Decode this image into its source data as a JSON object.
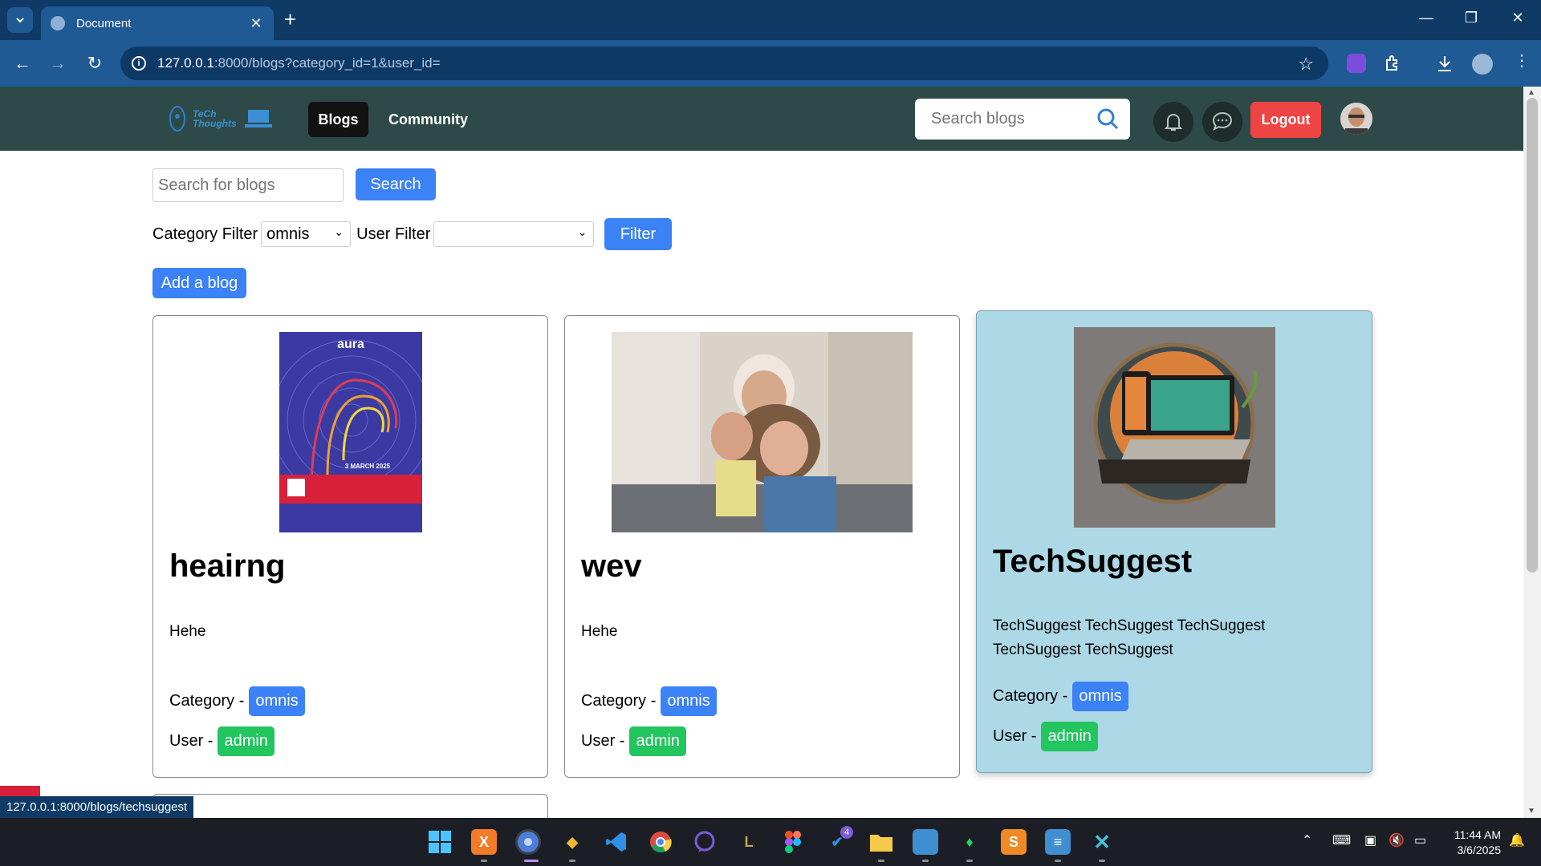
{
  "browser": {
    "tab_title": "Document",
    "url_host": "127.0.0.1",
    "url_rest": ":8000/blogs?category_id=1&user_id=",
    "status_url": "127.0.0.1:8000/blogs/techsuggest"
  },
  "navbar": {
    "logo_line1": "TeCh",
    "logo_line2": "Thoughts",
    "blogs_label": "Blogs",
    "community_label": "Community",
    "search_placeholder": "Search blogs",
    "logout_label": "Logout"
  },
  "page": {
    "search_placeholder": "Search for blogs",
    "search_button": "Search",
    "category_filter_label": "Category Filter",
    "category_selected": "omnis",
    "user_filter_label": "User Filter",
    "user_selected": "",
    "filter_button": "Filter",
    "add_blog_button": "Add a blog",
    "category_prefix": "Category -",
    "user_prefix": "User -"
  },
  "blogs": [
    {
      "title": "heairng",
      "description": "Hehe",
      "category": "omnis",
      "user": "admin",
      "poster_brand": "aura",
      "poster_subtitle": "3 MARCH 2025"
    },
    {
      "title": "wev",
      "description": "Hehe",
      "category": "omnis",
      "user": "admin"
    },
    {
      "title": "TechSuggest",
      "description": "TechSuggest TechSuggest TechSuggest TechSuggest TechSuggest",
      "category": "omnis",
      "user": "admin"
    }
  ],
  "taskbar": {
    "time": "11:44 AM",
    "date": "3/6/2025",
    "notification_count": "4"
  },
  "colors": {
    "accent_blue": "#3b82f6",
    "success_green": "#22c55e",
    "danger_red": "#ef4444",
    "navbar_bg": "#2d4a48",
    "hover_card_bg": "#add8e6"
  }
}
